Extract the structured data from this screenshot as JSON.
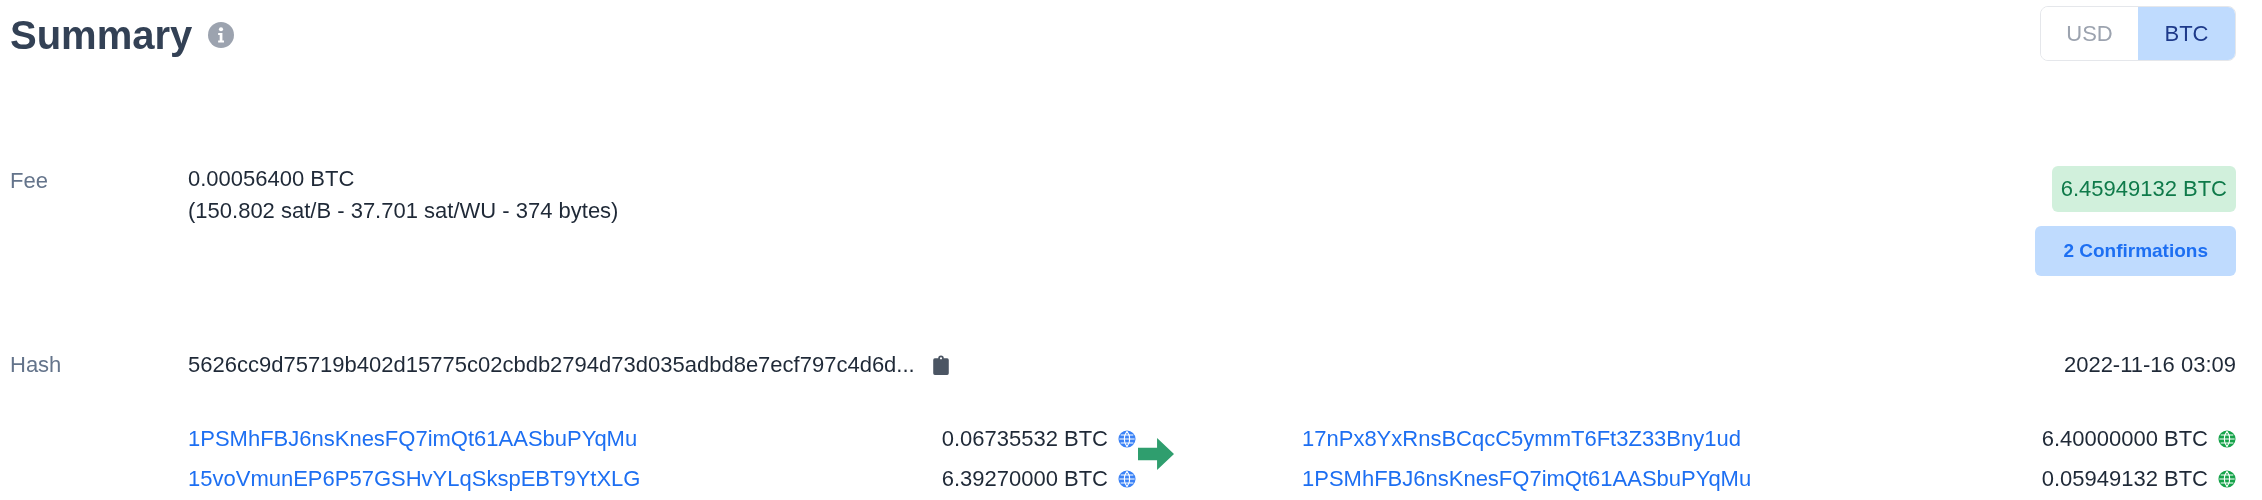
{
  "title": "Summary",
  "currency_toggle": [
    {
      "label": "USD",
      "selected": false
    },
    {
      "label": "BTC",
      "selected": true
    }
  ],
  "fee": {
    "label": "Fee",
    "amount": "0.00056400 BTC",
    "details": "(150.802 sat/B - 37.701 sat/WU - 374 bytes)"
  },
  "total": "6.45949132 BTC",
  "confirmations": "2 Confirmations",
  "hash": {
    "label": "Hash",
    "value": "5626cc9d75719b402d15775c02cbdb2794d73d035adbd8e7ecf797c4d6d...",
    "time": "2022-11-16 03:09"
  },
  "inputs": [
    {
      "address": "1PSMhFBJ6nsKnesFQ7imQt61AASbuPYqMu",
      "amount": "0.06735532 BTC",
      "spent": true
    },
    {
      "address": "15voVmunEP6P57GSHvYLqSkspEBT9YtXLG",
      "amount": "6.39270000 BTC",
      "spent": true
    }
  ],
  "outputs": [
    {
      "address": "17nPx8YxRnsBCqcC5ymmT6Ft3Z33Bny1ud",
      "amount": "6.40000000 BTC",
      "spent": false
    },
    {
      "address": "1PSMhFBJ6nsKnesFQ7imQt61AASbuPYqMu",
      "amount": "0.05949132 BTC",
      "spent": false
    }
  ]
}
